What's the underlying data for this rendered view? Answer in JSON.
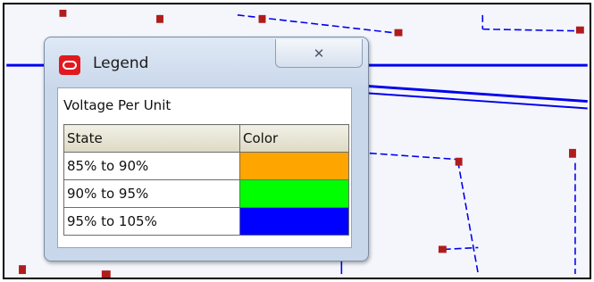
{
  "window": {
    "title": "Legend",
    "close_glyph": "✕",
    "app_icon": "app-logo-icon"
  },
  "legend": {
    "section_title": "Voltage Per Unit",
    "headers": {
      "state": "State",
      "color": "Color"
    },
    "rows": [
      {
        "state": "85% to 90%",
        "color": "#ffa500"
      },
      {
        "state": "90% to 95%",
        "color": "#00ff00"
      },
      {
        "state": "95% to 105%",
        "color": "#0000ff"
      }
    ]
  },
  "colors": {
    "line_blue": "#0000ee",
    "marker_red": "#b01c1c",
    "app_icon_red": "#e0191f"
  }
}
